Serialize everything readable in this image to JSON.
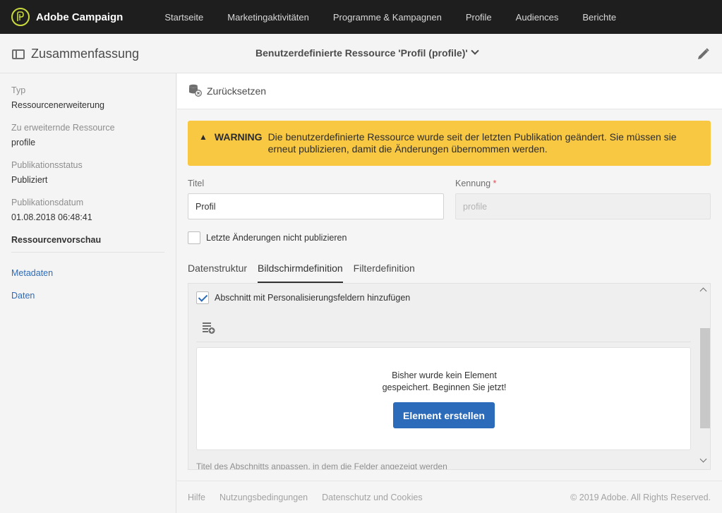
{
  "topbar": {
    "brand": "Adobe Campaign",
    "nav": [
      "Startseite",
      "Marketingaktivitäten",
      "Programme & Kampagnen",
      "Profile",
      "Audiences",
      "Berichte"
    ]
  },
  "subheader": {
    "summary_title": "Zusammenfassung",
    "resource_title": "Benutzerdefinierte Ressource 'Profil (profile)'"
  },
  "sidebar": {
    "props": [
      {
        "label": "Typ",
        "value": "Ressourcenerweiterung"
      },
      {
        "label": "Zu erweiternde Ressource",
        "value": "profile"
      },
      {
        "label": "Publikationsstatus",
        "value": "Publiziert"
      },
      {
        "label": "Publikationsdatum",
        "value": "01.08.2018 06:48:41"
      }
    ],
    "preview_heading": "Ressourcenvorschau",
    "links": [
      "Metadaten",
      "Daten"
    ]
  },
  "main": {
    "reset_label": "Zurücksetzen",
    "warning": {
      "title": "WARNING",
      "text": "Die benutzerdefinierte Ressource wurde seit der letzten Publikation geändert. Sie müssen sie erneut publizieren, damit die Änderungen übernommen werden."
    },
    "title_label": "Titel",
    "title_value": "Profil",
    "id_label": "Kennung",
    "id_required": "*",
    "id_placeholder": "profile",
    "no_publish_label": "Letzte Änderungen nicht publizieren",
    "tabs": [
      "Datenstruktur",
      "Bildschirmdefinition",
      "Filterdefinition"
    ],
    "active_tab": "Bildschirmdefinition",
    "section_checkbox_label": "Abschnitt mit Personalisierungsfeldern hinzufügen",
    "empty_line1": "Bisher wurde kein Element",
    "empty_line2": "gespeichert. Beginnen Sie jetzt!",
    "create_button": "Element erstellen",
    "cut_text": "Titel des Abschnitts anpassen, in dem die Felder angezeigt werden"
  },
  "footer": {
    "links": [
      "Hilfe",
      "Nutzungsbedingungen",
      "Datenschutz und Cookies"
    ],
    "copyright": "© 2019 Adobe. All Rights Reserved."
  },
  "colors": {
    "topbar": "#1e1e1e",
    "warning": "#f8c843",
    "primary": "#2c6bb9"
  }
}
